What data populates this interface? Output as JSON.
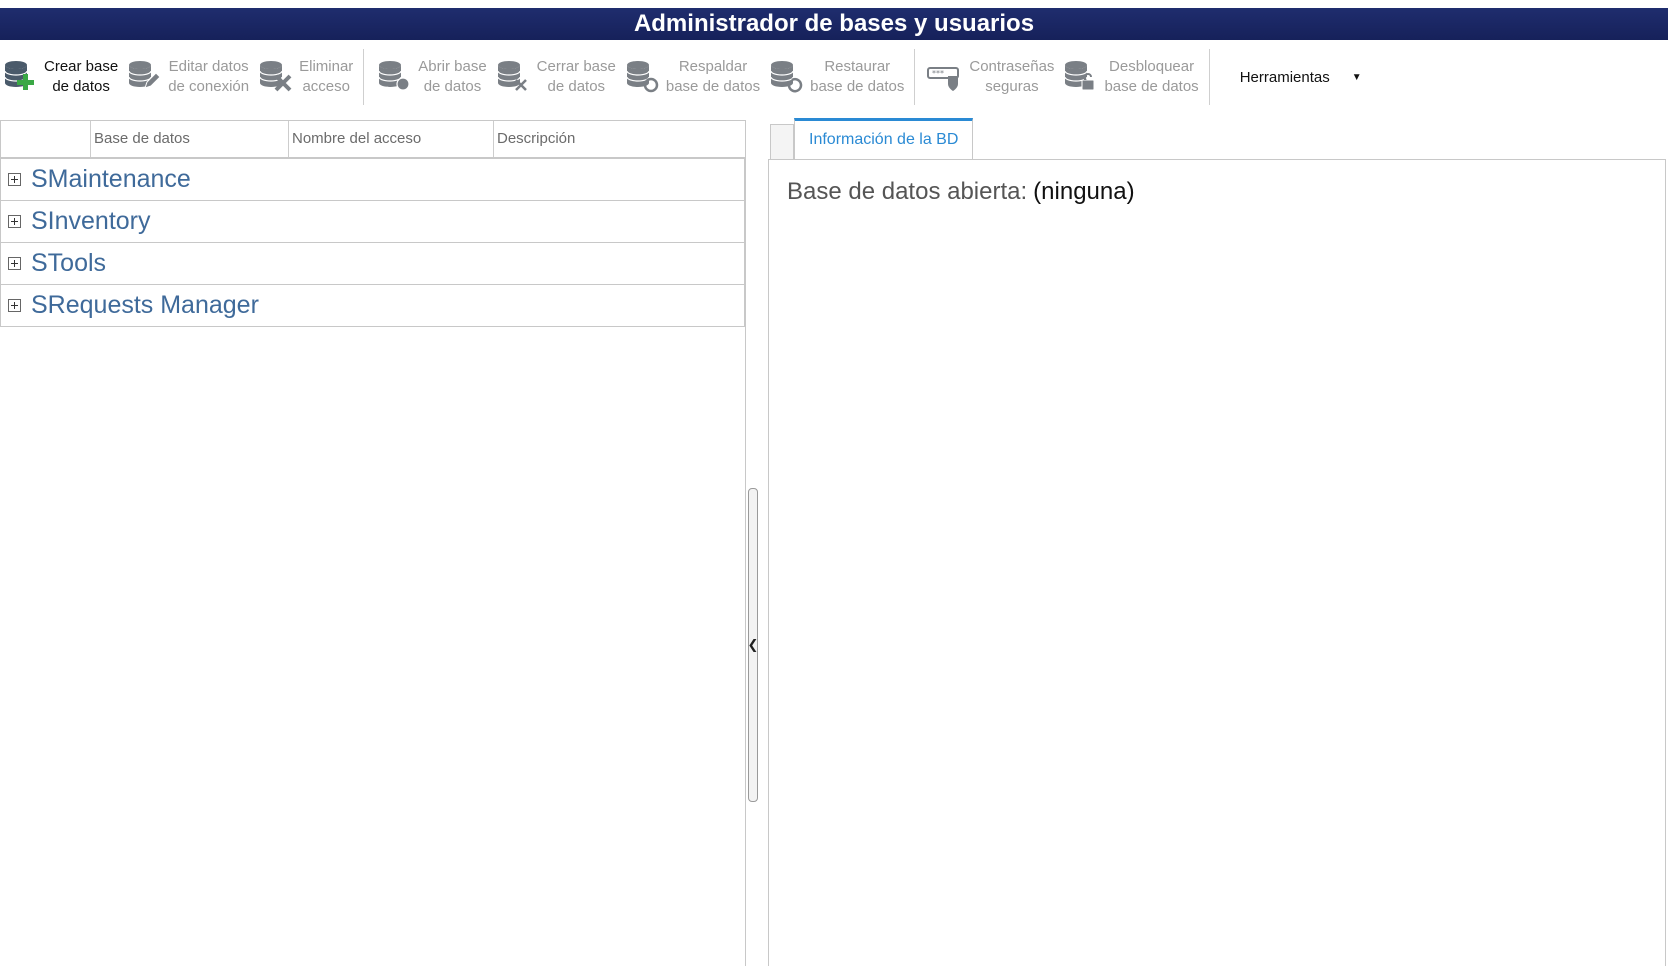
{
  "window": {
    "title": "Administrador de bases y usuarios"
  },
  "toolbar": {
    "groups": [
      [
        {
          "name": "crear-base-datos-button",
          "icon": "database-add-icon",
          "line1": "Crear base",
          "line2": "de datos",
          "enabled": true
        },
        {
          "name": "editar-conexion-button",
          "icon": "database-edit-icon",
          "line1": "Editar datos",
          "line2": "de conexión",
          "enabled": false
        },
        {
          "name": "eliminar-acceso-button",
          "icon": "database-delete-icon",
          "line1": "Eliminar",
          "line2": "acceso",
          "enabled": false
        }
      ],
      [
        {
          "name": "abrir-base-datos-button",
          "icon": "database-open-icon",
          "line1": "Abrir base",
          "line2": "de datos",
          "enabled": false
        },
        {
          "name": "cerrar-base-datos-button",
          "icon": "database-close-icon",
          "line1": "Cerrar base",
          "line2": "de datos",
          "enabled": false
        },
        {
          "name": "respaldar-base-datos-button",
          "icon": "database-backup-icon",
          "line1": "Respaldar",
          "line2": "base de datos",
          "enabled": false
        },
        {
          "name": "restaurar-base-datos-button",
          "icon": "database-restore-icon",
          "line1": "Restaurar",
          "line2": "base de datos",
          "enabled": false
        }
      ],
      [
        {
          "name": "contrasenas-seguras-button",
          "icon": "password-shield-icon",
          "line1": "Contraseñas",
          "line2": "seguras",
          "enabled": false
        },
        {
          "name": "desbloquear-base-datos-button",
          "icon": "database-unlock-icon",
          "line1": "Desbloquear",
          "line2": "base de datos",
          "enabled": false
        }
      ]
    ],
    "tools_menu": {
      "label": "Herramientas",
      "icon": "caret-down-icon"
    }
  },
  "grid": {
    "columns": [
      "",
      "Base de datos",
      "Nombre del acceso",
      "Descripción"
    ],
    "rows": [
      {
        "label": "SMaintenance"
      },
      {
        "label": "SInventory"
      },
      {
        "label": "STools"
      },
      {
        "label": "SRequests Manager"
      }
    ]
  },
  "splitter": {
    "icon": "chevron-left-icon"
  },
  "details": {
    "tab_label": "Información de la BD",
    "open_db_label": "Base de datos abierta:",
    "open_db_value": "(ninguna)"
  },
  "colors": {
    "title_bg": "#1b2764",
    "tab_accent": "#2a8ad4",
    "tree_text": "#3f6a9a",
    "icon_enabled": "#4a5a6a",
    "icon_disabled": "#7a7f85",
    "icon_plus": "#3aa845"
  }
}
